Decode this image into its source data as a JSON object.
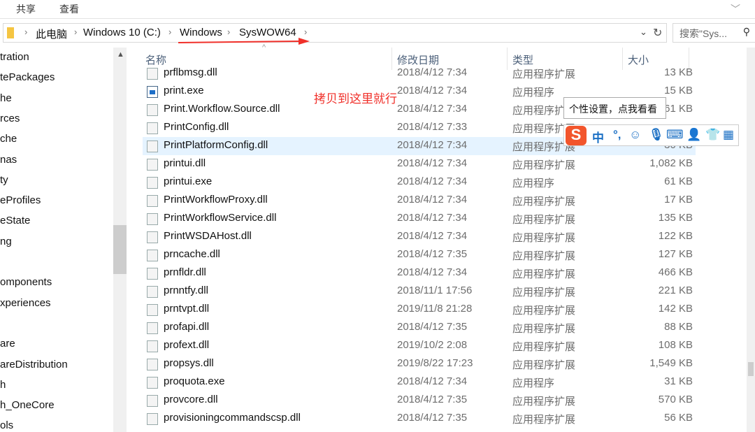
{
  "ribbon": {
    "tabs": [
      "共享",
      "查看"
    ]
  },
  "address": {
    "crumbs": [
      "此电脑",
      "Windows 10 (C:)",
      "Windows",
      "SysWOW64"
    ]
  },
  "search": {
    "placeholder": "搜索\"Sys..."
  },
  "sidebar": {
    "items": [
      "tration",
      "tePackages",
      "he",
      "rces",
      "che",
      "nas",
      "ty",
      "eProfiles",
      "eState",
      "ng",
      "",
      "omponents",
      "xperiences",
      "",
      "are",
      "areDistribution",
      "h",
      "h_OneCore",
      "ols"
    ]
  },
  "columns": {
    "name": "名称",
    "date": "修改日期",
    "type": "类型",
    "size": "大小"
  },
  "files": [
    {
      "name": "prflbmsg.dll",
      "date": "2018/4/12 7:34",
      "type": "应用程序扩展",
      "size": "13 KB",
      "icon": "dll"
    },
    {
      "name": "print.exe",
      "date": "2018/4/12 7:34",
      "type": "应用程序",
      "size": "15 KB",
      "icon": "exe"
    },
    {
      "name": "Print.Workflow.Source.dll",
      "date": "2018/4/12 7:34",
      "type": "应用程序扩展",
      "size": "61 KB",
      "icon": "dll"
    },
    {
      "name": "PrintConfig.dll",
      "date": "2018/4/12 7:33",
      "type": "应用程序扩展",
      "size": "",
      "icon": "dll"
    },
    {
      "name": "PrintPlatformConfig.dll",
      "date": "2018/4/12 7:34",
      "type": "应用程序扩展",
      "size": "30 KB",
      "icon": "dll",
      "selected": true
    },
    {
      "name": "printui.dll",
      "date": "2018/4/12 7:34",
      "type": "应用程序扩展",
      "size": "1,082 KB",
      "icon": "dll"
    },
    {
      "name": "printui.exe",
      "date": "2018/4/12 7:34",
      "type": "应用程序",
      "size": "61 KB",
      "icon": "printer"
    },
    {
      "name": "PrintWorkflowProxy.dll",
      "date": "2018/4/12 7:34",
      "type": "应用程序扩展",
      "size": "17 KB",
      "icon": "dll"
    },
    {
      "name": "PrintWorkflowService.dll",
      "date": "2018/4/12 7:34",
      "type": "应用程序扩展",
      "size": "135 KB",
      "icon": "dll"
    },
    {
      "name": "PrintWSDAHost.dll",
      "date": "2018/4/12 7:34",
      "type": "应用程序扩展",
      "size": "122 KB",
      "icon": "dll"
    },
    {
      "name": "prncache.dll",
      "date": "2018/4/12 7:35",
      "type": "应用程序扩展",
      "size": "127 KB",
      "icon": "dll"
    },
    {
      "name": "prnfldr.dll",
      "date": "2018/4/12 7:34",
      "type": "应用程序扩展",
      "size": "466 KB",
      "icon": "dll"
    },
    {
      "name": "prnntfy.dll",
      "date": "2018/11/1 17:56",
      "type": "应用程序扩展",
      "size": "221 KB",
      "icon": "dll"
    },
    {
      "name": "prntvpt.dll",
      "date": "2019/11/8 21:28",
      "type": "应用程序扩展",
      "size": "142 KB",
      "icon": "dll"
    },
    {
      "name": "profapi.dll",
      "date": "2018/4/12 7:35",
      "type": "应用程序扩展",
      "size": "88 KB",
      "icon": "dll"
    },
    {
      "name": "profext.dll",
      "date": "2019/10/2 2:08",
      "type": "应用程序扩展",
      "size": "108 KB",
      "icon": "dll"
    },
    {
      "name": "propsys.dll",
      "date": "2019/8/22 17:23",
      "type": "应用程序扩展",
      "size": "1,549 KB",
      "icon": "dll"
    },
    {
      "name": "proquota.exe",
      "date": "2018/4/12 7:34",
      "type": "应用程序",
      "size": "31 KB",
      "icon": "app"
    },
    {
      "name": "provcore.dll",
      "date": "2018/4/12 7:35",
      "type": "应用程序扩展",
      "size": "570 KB",
      "icon": "dll"
    },
    {
      "name": "provisioningcommandscsp.dll",
      "date": "2018/4/12 7:35",
      "type": "应用程序扩展",
      "size": "56 KB",
      "icon": "dll"
    }
  ],
  "annotation": {
    "text": "拷贝到这里就行",
    "color": "#f0302a"
  },
  "ime": {
    "tooltip": "个性设置，点我看看",
    "logo": "S",
    "mode": "中",
    "punct": "°,"
  }
}
